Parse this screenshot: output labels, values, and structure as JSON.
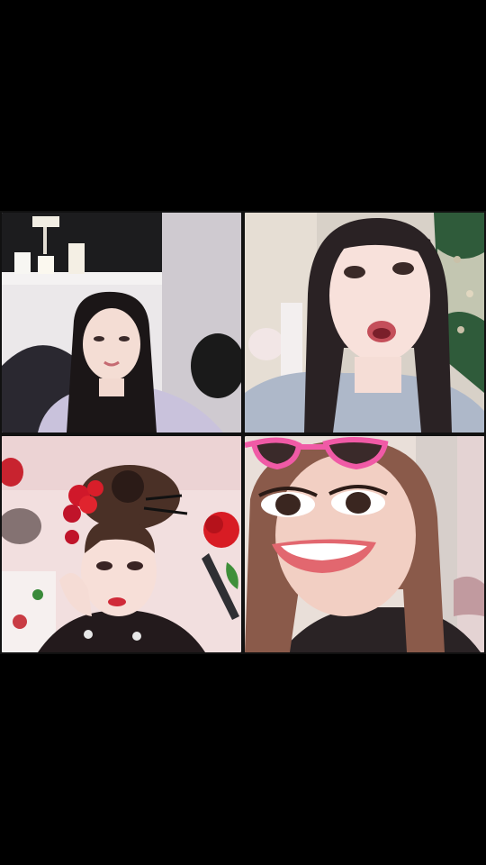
{
  "participants": [
    {
      "slot": "top-left"
    },
    {
      "slot": "top-right"
    },
    {
      "slot": "bottom-left"
    },
    {
      "slot": "bottom-right"
    }
  ],
  "colors": {
    "background": "#000000",
    "divider": "#111111"
  }
}
